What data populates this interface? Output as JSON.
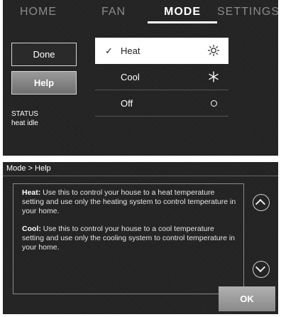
{
  "nav": {
    "tabs": [
      {
        "label": "HOME"
      },
      {
        "label": "FAN"
      },
      {
        "label": "MODE"
      },
      {
        "label": "SETTINGS"
      }
    ],
    "active_tab": "MODE"
  },
  "buttons": {
    "done_label": "Done",
    "help_label": "Help"
  },
  "status": {
    "label": "STATUS",
    "value": "heat idle"
  },
  "modes": {
    "items": [
      {
        "label": "Heat",
        "icon": "sun-icon",
        "selected": true,
        "check": "✓"
      },
      {
        "label": "Cool",
        "icon": "snowflake-icon",
        "selected": false
      },
      {
        "label": "Off",
        "icon": "circle-icon",
        "selected": false
      }
    ]
  },
  "help": {
    "title": "Mode > Help",
    "paragraphs": [
      {
        "heading": "Heat:",
        "text": " Use this to control your house to a heat temperature setting and use only the heating system to control temperature in your home."
      },
      {
        "heading": "Cool:",
        "text": " Use this to control your house to a cool temperature setting and use only the cooling system to control temperature in your home."
      }
    ],
    "ok_label": "OK"
  },
  "colors": {
    "panel_bg": "#222222",
    "selected_bg": "#ffffff",
    "help_button_bg": "#8a8a8a",
    "ok_button_bg": "#9c9c9c"
  }
}
